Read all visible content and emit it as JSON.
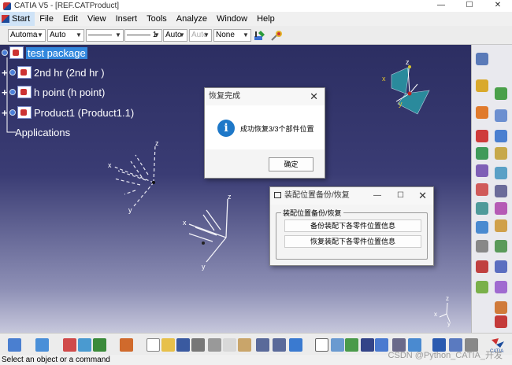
{
  "window": {
    "title": "CATIA V5 - [REF.CATProduct]",
    "controls": [
      "—",
      "☐",
      "✕"
    ]
  },
  "menu": {
    "items": [
      "Start",
      "File",
      "Edit",
      "View",
      "Insert",
      "Tools",
      "Analyze",
      "Window",
      "Help"
    ]
  },
  "toolbar": {
    "combos": [
      "Automa",
      "Auto",
      "———",
      "——— 1",
      "Auto",
      "Auto",
      "None"
    ]
  },
  "tree": {
    "root": "test package",
    "children": [
      "2nd hr  (2nd hr )",
      "h point (h point)",
      "Product1 (Product1.1)"
    ],
    "applications": "Applications"
  },
  "axes": {
    "x": "x",
    "y": "y",
    "z": "z"
  },
  "dialog_complete": {
    "title": "恢复完成",
    "info_icon": "i",
    "message": "成功恢复3/3个部件位置",
    "ok_label": "确定",
    "close": "✕"
  },
  "dialog_backup": {
    "title": "装配位置备份/恢复",
    "group_label": "装配位置备份/恢复",
    "backup_button": "备份装配下各零件位置信息",
    "restore_button": "恢复装配下各零件位置信息",
    "minimize": "—",
    "maximize": "☐",
    "close": "✕"
  },
  "status": {
    "text": "Select an object or a command"
  },
  "watermark": "CSDN @Python_CATIA_开发",
  "colors": {
    "viewport_top": "#2c2e62",
    "selection": "#3388dd",
    "info": "#1e78c8"
  }
}
